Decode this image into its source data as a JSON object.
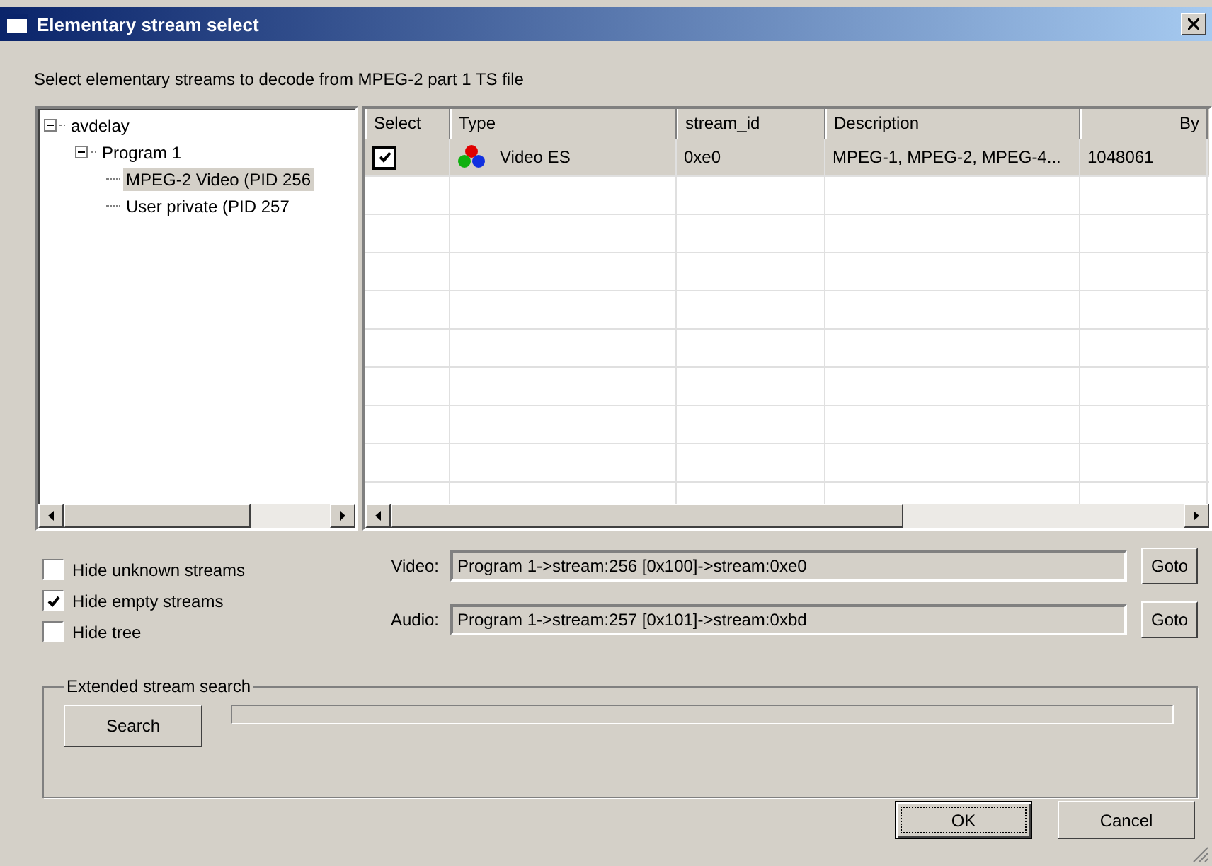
{
  "window": {
    "title": "Elementary stream select"
  },
  "instruction": "Select elementary streams to decode from MPEG-2 part 1 TS file",
  "tree": [
    {
      "label": "avdelay",
      "expanded": true,
      "selected": false,
      "children": [
        {
          "label": "Program 1",
          "expanded": true,
          "selected": false,
          "children": [
            {
              "label": "MPEG-2 Video (PID 256",
              "selected": true
            },
            {
              "label": "User private (PID 257",
              "selected": false
            }
          ]
        }
      ]
    }
  ],
  "table": {
    "columns": [
      "Select",
      "Type",
      "stream_id",
      "Description",
      "By"
    ],
    "rows": [
      {
        "checked": true,
        "type": "Video ES",
        "stream_id": "0xe0",
        "description": "MPEG-1, MPEG-2, MPEG-4...",
        "column_5": "1048061"
      }
    ]
  },
  "options": [
    {
      "label": "Hide unknown streams",
      "checked": false
    },
    {
      "label": "Hide empty streams",
      "checked": true
    },
    {
      "label": "Hide tree",
      "checked": false
    }
  ],
  "streams": [
    {
      "label": "Video:",
      "value": "Program 1->stream:256 [0x100]->stream:0xe0",
      "button": "Goto"
    },
    {
      "label": "Audio:",
      "value": "Program 1->stream:257 [0x101]->stream:0xbd",
      "button": "Goto"
    }
  ],
  "search_group": {
    "title": "Extended stream search",
    "button": "Search"
  },
  "buttons": [
    {
      "label": "OK",
      "default": true
    },
    {
      "label": "Cancel",
      "default": false
    }
  ]
}
